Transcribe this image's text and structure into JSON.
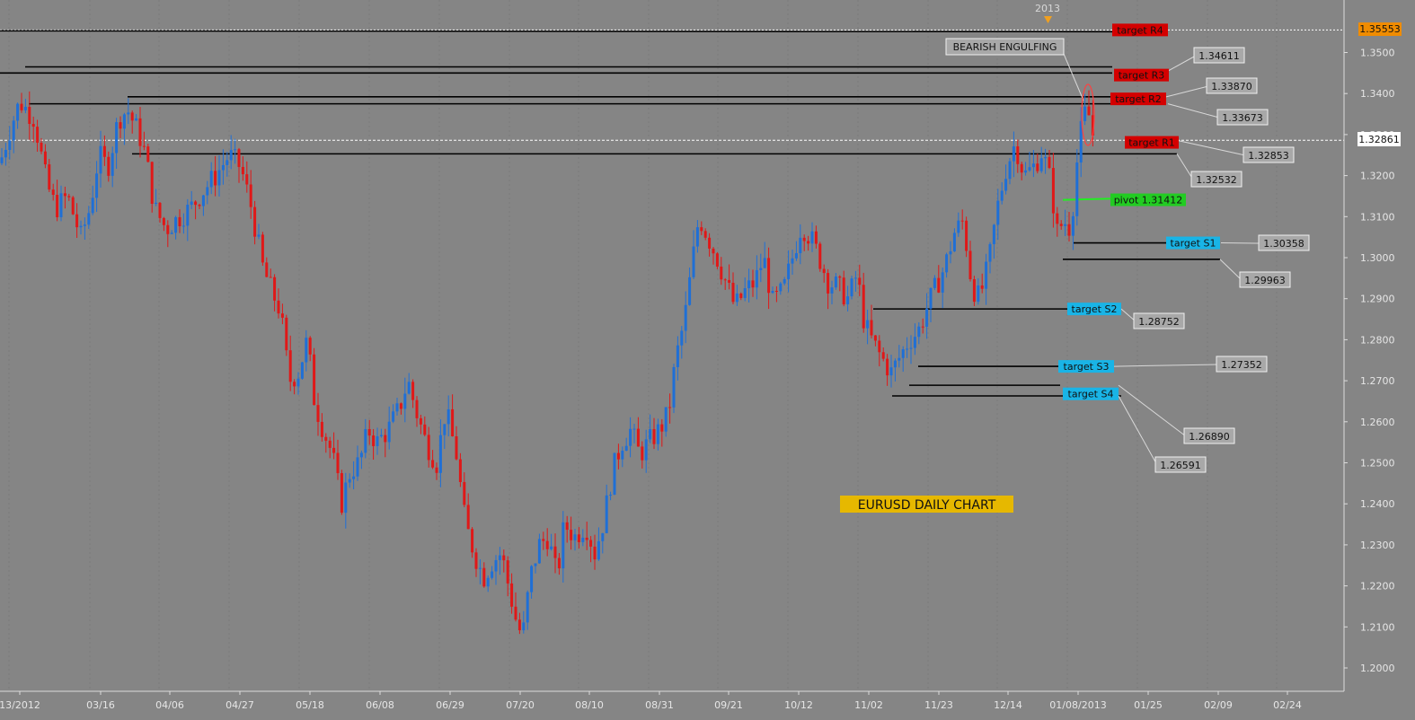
{
  "chart_data": {
    "type": "candlestick",
    "title": "EURUSD DAILY CHART",
    "year_marker": "2013",
    "y_ticks": [
      "1.3500",
      "1.3400",
      "1.3300",
      "1.3200",
      "1.3100",
      "1.3000",
      "1.2900",
      "1.2800",
      "1.2700",
      "1.2600",
      "1.2500",
      "1.2400",
      "1.2300",
      "1.2200",
      "1.2100",
      "1.2000"
    ],
    "ylim": [
      1.1955,
      1.359
    ],
    "x_labels": [
      "13/2012",
      "03/16",
      "04/06",
      "04/27",
      "05/18",
      "06/08",
      "06/29",
      "07/20",
      "08/10",
      "08/31",
      "09/21",
      "10/12",
      "11/02",
      "11/23",
      "12/14",
      "01/08/2013",
      "01/25",
      "02/09",
      "02/24"
    ],
    "current_price": "1.32861",
    "top_price_tag": "1.35553",
    "pattern_label": "BEARISH ENGULFING",
    "targets": [
      {
        "label": "target R4",
        "color": "#d40000"
      },
      {
        "label": "target R3",
        "color": "#d40000"
      },
      {
        "label": "target R2",
        "color": "#d40000"
      },
      {
        "label": "target R1",
        "color": "#d40000"
      },
      {
        "label": "pivot 1.31412",
        "color": "#22cc22"
      },
      {
        "label": "target S1",
        "color": "#19b4e6"
      },
      {
        "label": "target S2",
        "color": "#19b4e6"
      },
      {
        "label": "target S3",
        "color": "#19b4e6"
      },
      {
        "label": "target S4",
        "color": "#19b4e6"
      }
    ],
    "price_labels": [
      "1.34611",
      "1.33870",
      "1.33673",
      "1.32853",
      "1.32532",
      "1.30358",
      "1.29963",
      "1.28752",
      "1.27352",
      "1.26890",
      "1.26591"
    ],
    "levels": [
      1.3555,
      1.3461,
      1.3387,
      1.3367,
      1.3285,
      1.3253,
      1.3141,
      1.3036,
      1.2996,
      1.2875,
      1.2735,
      1.2689,
      1.2659
    ],
    "close_path": [
      [
        0,
        1.323
      ],
      [
        12,
        1.332
      ],
      [
        22,
        1.338
      ],
      [
        38,
        1.334
      ],
      [
        52,
        1.318
      ],
      [
        62,
        1.312
      ],
      [
        75,
        1.315
      ],
      [
        90,
        1.305
      ],
      [
        100,
        1.312
      ],
      [
        110,
        1.325
      ],
      [
        120,
        1.322
      ],
      [
        132,
        1.334
      ],
      [
        142,
        1.336
      ],
      [
        155,
        1.33
      ],
      [
        162,
        1.325
      ],
      [
        172,
        1.312
      ],
      [
        185,
        1.307
      ],
      [
        200,
        1.31
      ],
      [
        212,
        1.312
      ],
      [
        225,
        1.316
      ],
      [
        240,
        1.32
      ],
      [
        255,
        1.325
      ],
      [
        268,
        1.322
      ],
      [
        280,
        1.312
      ],
      [
        292,
        1.298
      ],
      [
        302,
        1.292
      ],
      [
        312,
        1.287
      ],
      [
        322,
        1.27
      ],
      [
        332,
        1.272
      ],
      [
        342,
        1.28
      ],
      [
        350,
        1.265
      ],
      [
        360,
        1.258
      ],
      [
        370,
        1.252
      ],
      [
        380,
        1.24
      ],
      [
        390,
        1.248
      ],
      [
        400,
        1.25
      ],
      [
        410,
        1.258
      ],
      [
        420,
        1.255
      ],
      [
        432,
        1.258
      ],
      [
        444,
        1.263
      ],
      [
        454,
        1.27
      ],
      [
        464,
        1.262
      ],
      [
        474,
        1.255
      ],
      [
        486,
        1.25
      ],
      [
        496,
        1.263
      ],
      [
        508,
        1.252
      ],
      [
        518,
        1.235
      ],
      [
        528,
        1.228
      ],
      [
        538,
        1.222
      ],
      [
        548,
        1.226
      ],
      [
        558,
        1.228
      ],
      [
        566,
        1.22
      ],
      [
        576,
        1.21
      ],
      [
        582,
        1.208
      ],
      [
        590,
        1.222
      ],
      [
        600,
        1.23
      ],
      [
        610,
        1.232
      ],
      [
        620,
        1.222
      ],
      [
        628,
        1.235
      ],
      [
        640,
        1.232
      ],
      [
        652,
        1.235
      ],
      [
        662,
        1.228
      ],
      [
        672,
        1.236
      ],
      [
        682,
        1.248
      ],
      [
        692,
        1.255
      ],
      [
        702,
        1.258
      ],
      [
        712,
        1.252
      ],
      [
        722,
        1.255
      ],
      [
        734,
        1.258
      ],
      [
        744,
        1.262
      ],
      [
        752,
        1.275
      ],
      [
        762,
        1.285
      ],
      [
        770,
        1.298
      ],
      [
        778,
        1.31
      ],
      [
        788,
        1.305
      ],
      [
        798,
        1.3
      ],
      [
        808,
        1.294
      ],
      [
        818,
        1.288
      ],
      [
        830,
        1.292
      ],
      [
        840,
        1.294
      ],
      [
        850,
        1.3
      ],
      [
        860,
        1.289
      ],
      [
        872,
        1.292
      ],
      [
        882,
        1.3
      ],
      [
        892,
        1.308
      ],
      [
        902,
        1.305
      ],
      [
        912,
        1.3
      ],
      [
        922,
        1.294
      ],
      [
        932,
        1.293
      ],
      [
        944,
        1.29
      ],
      [
        954,
        1.296
      ],
      [
        962,
        1.284
      ],
      [
        970,
        1.28
      ],
      [
        980,
        1.276
      ],
      [
        992,
        1.272
      ],
      [
        1002,
        1.276
      ],
      [
        1012,
        1.28
      ],
      [
        1022,
        1.282
      ],
      [
        1032,
        1.288
      ],
      [
        1042,
        1.293
      ],
      [
        1052,
        1.298
      ],
      [
        1062,
        1.306
      ],
      [
        1072,
        1.309
      ],
      [
        1082,
        1.293
      ],
      [
        1090,
        1.29
      ],
      [
        1100,
        1.298
      ],
      [
        1110,
        1.312
      ],
      [
        1120,
        1.322
      ],
      [
        1130,
        1.328
      ],
      [
        1140,
        1.32
      ],
      [
        1150,
        1.322
      ],
      [
        1160,
        1.326
      ],
      [
        1170,
        1.318
      ],
      [
        1176,
        1.306
      ],
      [
        1184,
        1.309
      ],
      [
        1192,
        1.307
      ],
      [
        1198,
        1.322
      ],
      [
        1204,
        1.332
      ],
      [
        1210,
        1.337
      ],
      [
        1216,
        1.33
      ]
    ]
  }
}
